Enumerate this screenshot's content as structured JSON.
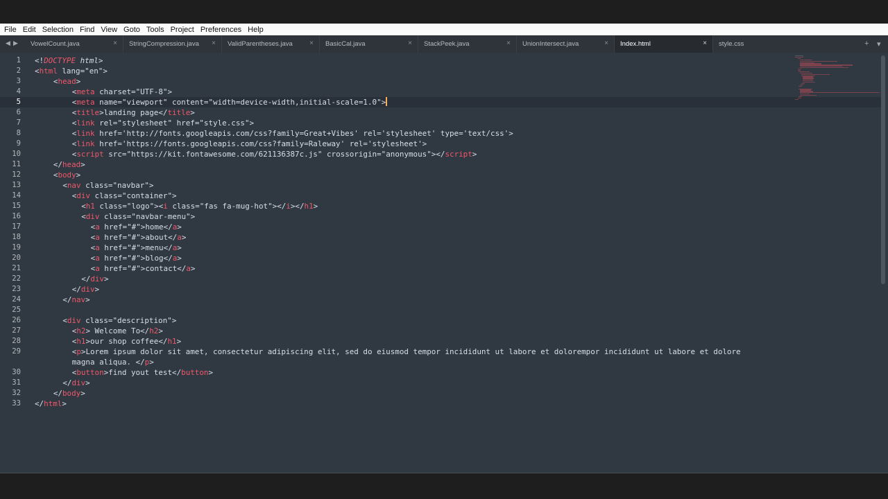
{
  "menu": [
    "File",
    "Edit",
    "Selection",
    "Find",
    "View",
    "Goto",
    "Tools",
    "Project",
    "Preferences",
    "Help"
  ],
  "tabs": [
    {
      "label": "VowelCount.java",
      "active": false
    },
    {
      "label": "StringCompression.java",
      "active": false
    },
    {
      "label": "ValidParentheses.java",
      "active": false
    },
    {
      "label": "BasicCal.java",
      "active": false
    },
    {
      "label": "StackPeek.java",
      "active": false
    },
    {
      "label": "UnionIntersect.java",
      "active": false
    },
    {
      "label": "Index.html",
      "active": true
    },
    {
      "label": "style.css",
      "active": false
    }
  ],
  "icons": {
    "nav_left": "◀",
    "nav_right": "▶",
    "close": "×",
    "new_tab": "+",
    "tab_list": "▾"
  },
  "colors": {
    "editor_bg": "#303841",
    "tag": "#f0586b",
    "text": "#d8dee9",
    "caret": "#f9ae58",
    "tab_bar": "#2f343a",
    "active_tab": "#272b30"
  },
  "editor": {
    "current_line": 5,
    "lines": [
      {
        "n": "1",
        "indent": 0,
        "tokens": [
          [
            "punc",
            "<!"
          ],
          [
            "doctype-kw",
            "DOCTYPE"
          ],
          [
            "punc",
            " "
          ],
          [
            "doctype",
            "html"
          ],
          [
            "punc",
            ">"
          ]
        ]
      },
      {
        "n": "2",
        "indent": 0,
        "tokens": [
          [
            "punc",
            "<"
          ],
          [
            "tag",
            "html"
          ],
          [
            "attr",
            " lang="
          ],
          [
            "str",
            "\"en\""
          ],
          [
            "punc",
            ">"
          ]
        ]
      },
      {
        "n": "3",
        "indent": 4,
        "tokens": [
          [
            "punc",
            "<"
          ],
          [
            "tag",
            "head"
          ],
          [
            "punc",
            ">"
          ]
        ]
      },
      {
        "n": "4",
        "indent": 8,
        "tokens": [
          [
            "punc",
            "<"
          ],
          [
            "tag",
            "meta"
          ],
          [
            "attr",
            " charset="
          ],
          [
            "str",
            "\"UTF-8\""
          ],
          [
            "punc",
            ">"
          ]
        ]
      },
      {
        "n": "5",
        "indent": 8,
        "tokens": [
          [
            "punc",
            "<"
          ],
          [
            "tag",
            "meta"
          ],
          [
            "attr",
            " name="
          ],
          [
            "str",
            "\"viewport\""
          ],
          [
            "attr",
            " content="
          ],
          [
            "str",
            "\"width=device-width,initial-scale=1.0\""
          ],
          [
            "punc",
            ">"
          ],
          [
            "caret",
            ""
          ]
        ]
      },
      {
        "n": "6",
        "indent": 8,
        "tokens": [
          [
            "punc",
            "<"
          ],
          [
            "tag",
            "title"
          ],
          [
            "punc",
            ">"
          ],
          [
            "text",
            "landing page"
          ],
          [
            "punc",
            "</"
          ],
          [
            "tag",
            "title"
          ],
          [
            "punc",
            ">"
          ]
        ]
      },
      {
        "n": "7",
        "indent": 8,
        "tokens": [
          [
            "punc",
            "<"
          ],
          [
            "tag",
            "link"
          ],
          [
            "attr",
            " rel="
          ],
          [
            "str",
            "\"stylesheet\""
          ],
          [
            "attr",
            " href="
          ],
          [
            "str",
            "\"style.css\""
          ],
          [
            "punc",
            ">"
          ]
        ]
      },
      {
        "n": "8",
        "indent": 8,
        "tokens": [
          [
            "punc",
            "<"
          ],
          [
            "tag",
            "link"
          ],
          [
            "attr",
            " href="
          ],
          [
            "str",
            "'http://fonts.googleapis.com/css?family=Great+Vibes'"
          ],
          [
            "attr",
            " rel="
          ],
          [
            "str",
            "'stylesheet'"
          ],
          [
            "attr",
            " type="
          ],
          [
            "str",
            "'text/css'"
          ],
          [
            "punc",
            ">"
          ]
        ]
      },
      {
        "n": "9",
        "indent": 8,
        "tokens": [
          [
            "punc",
            "<"
          ],
          [
            "tag",
            "link"
          ],
          [
            "attr",
            " href="
          ],
          [
            "str",
            "'https://fonts.googleapis.com/css?family=Raleway'"
          ],
          [
            "attr",
            " rel="
          ],
          [
            "str",
            "'stylesheet'"
          ],
          [
            "punc",
            ">"
          ]
        ]
      },
      {
        "n": "10",
        "indent": 8,
        "tokens": [
          [
            "punc",
            "<"
          ],
          [
            "tag",
            "script"
          ],
          [
            "attr",
            " src="
          ],
          [
            "str",
            "\"https://kit.fontawesome.com/621136387c.js\""
          ],
          [
            "attr",
            " crossorigin="
          ],
          [
            "str",
            "\"anonymous\""
          ],
          [
            "punc",
            "></"
          ],
          [
            "tag",
            "script"
          ],
          [
            "punc",
            ">"
          ]
        ]
      },
      {
        "n": "11",
        "indent": 4,
        "tokens": [
          [
            "punc",
            "</"
          ],
          [
            "tag",
            "head"
          ],
          [
            "punc",
            ">"
          ]
        ]
      },
      {
        "n": "12",
        "indent": 4,
        "tokens": [
          [
            "punc",
            "<"
          ],
          [
            "tag",
            "body"
          ],
          [
            "punc",
            ">"
          ]
        ]
      },
      {
        "n": "13",
        "indent": 6,
        "tokens": [
          [
            "punc",
            "<"
          ],
          [
            "tag",
            "nav"
          ],
          [
            "attr",
            " class="
          ],
          [
            "str",
            "\"navbar\""
          ],
          [
            "punc",
            ">"
          ]
        ]
      },
      {
        "n": "14",
        "indent": 8,
        "tokens": [
          [
            "punc",
            "<"
          ],
          [
            "tag",
            "div"
          ],
          [
            "attr",
            " class="
          ],
          [
            "str",
            "\"container\""
          ],
          [
            "punc",
            ">"
          ]
        ]
      },
      {
        "n": "15",
        "indent": 10,
        "tokens": [
          [
            "punc",
            "<"
          ],
          [
            "tag",
            "h1"
          ],
          [
            "attr",
            " class="
          ],
          [
            "str",
            "\"logo\""
          ],
          [
            "punc",
            ">"
          ],
          [
            "punc",
            "<"
          ],
          [
            "tag",
            "i"
          ],
          [
            "attr",
            " class="
          ],
          [
            "str",
            "\"fas fa-mug-hot\""
          ],
          [
            "punc",
            "></"
          ],
          [
            "tag",
            "i"
          ],
          [
            "punc",
            "></"
          ],
          [
            "tag",
            "h1"
          ],
          [
            "punc",
            ">"
          ]
        ]
      },
      {
        "n": "16",
        "indent": 10,
        "tokens": [
          [
            "punc",
            "<"
          ],
          [
            "tag",
            "div"
          ],
          [
            "attr",
            " class="
          ],
          [
            "str",
            "\"navbar-menu\""
          ],
          [
            "punc",
            ">"
          ]
        ]
      },
      {
        "n": "17",
        "indent": 12,
        "tokens": [
          [
            "punc",
            "<"
          ],
          [
            "tag",
            "a"
          ],
          [
            "attr",
            " href="
          ],
          [
            "str",
            "\"#\""
          ],
          [
            "punc",
            ">"
          ],
          [
            "text",
            "home"
          ],
          [
            "punc",
            "</"
          ],
          [
            "tag",
            "a"
          ],
          [
            "punc",
            ">"
          ]
        ]
      },
      {
        "n": "18",
        "indent": 12,
        "tokens": [
          [
            "punc",
            "<"
          ],
          [
            "tag",
            "a"
          ],
          [
            "attr",
            " href="
          ],
          [
            "str",
            "\"#\""
          ],
          [
            "punc",
            ">"
          ],
          [
            "text",
            "about"
          ],
          [
            "punc",
            "</"
          ],
          [
            "tag",
            "a"
          ],
          [
            "punc",
            ">"
          ]
        ]
      },
      {
        "n": "19",
        "indent": 12,
        "tokens": [
          [
            "punc",
            "<"
          ],
          [
            "tag",
            "a"
          ],
          [
            "attr",
            " href="
          ],
          [
            "str",
            "\"#\""
          ],
          [
            "punc",
            ">"
          ],
          [
            "text",
            "menu"
          ],
          [
            "punc",
            "</"
          ],
          [
            "tag",
            "a"
          ],
          [
            "punc",
            ">"
          ]
        ]
      },
      {
        "n": "20",
        "indent": 12,
        "tokens": [
          [
            "punc",
            "<"
          ],
          [
            "tag",
            "a"
          ],
          [
            "attr",
            " href="
          ],
          [
            "str",
            "\"#\""
          ],
          [
            "punc",
            ">"
          ],
          [
            "text",
            "blog"
          ],
          [
            "punc",
            "</"
          ],
          [
            "tag",
            "a"
          ],
          [
            "punc",
            ">"
          ]
        ]
      },
      {
        "n": "21",
        "indent": 12,
        "tokens": [
          [
            "punc",
            "<"
          ],
          [
            "tag",
            "a"
          ],
          [
            "attr",
            " href="
          ],
          [
            "str",
            "\"#\""
          ],
          [
            "punc",
            ">"
          ],
          [
            "text",
            "contact"
          ],
          [
            "punc",
            "</"
          ],
          [
            "tag",
            "a"
          ],
          [
            "punc",
            ">"
          ]
        ]
      },
      {
        "n": "22",
        "indent": 10,
        "tokens": [
          [
            "punc",
            "</"
          ],
          [
            "tag",
            "div"
          ],
          [
            "punc",
            ">"
          ]
        ]
      },
      {
        "n": "23",
        "indent": 8,
        "tokens": [
          [
            "punc",
            "</"
          ],
          [
            "tag",
            "div"
          ],
          [
            "punc",
            ">"
          ]
        ]
      },
      {
        "n": "24",
        "indent": 6,
        "tokens": [
          [
            "punc",
            "</"
          ],
          [
            "tag",
            "nav"
          ],
          [
            "punc",
            ">"
          ]
        ]
      },
      {
        "n": "25",
        "indent": 0,
        "tokens": []
      },
      {
        "n": "26",
        "indent": 6,
        "tokens": [
          [
            "punc",
            "<"
          ],
          [
            "tag",
            "div"
          ],
          [
            "attr",
            " class="
          ],
          [
            "str",
            "\"description\""
          ],
          [
            "punc",
            ">"
          ]
        ]
      },
      {
        "n": "27",
        "indent": 8,
        "tokens": [
          [
            "punc",
            "<"
          ],
          [
            "tag",
            "h2"
          ],
          [
            "punc",
            ">"
          ],
          [
            "text",
            " Welcome To"
          ],
          [
            "punc",
            "</"
          ],
          [
            "tag",
            "h2"
          ],
          [
            "punc",
            ">"
          ]
        ]
      },
      {
        "n": "28",
        "indent": 8,
        "tokens": [
          [
            "punc",
            "<"
          ],
          [
            "tag",
            "h1"
          ],
          [
            "punc",
            ">"
          ],
          [
            "text",
            "our shop coffee"
          ],
          [
            "punc",
            "</"
          ],
          [
            "tag",
            "h1"
          ],
          [
            "punc",
            ">"
          ]
        ]
      },
      {
        "n": "29",
        "indent": 8,
        "tokens": [
          [
            "punc",
            "<"
          ],
          [
            "tag",
            "p"
          ],
          [
            "punc",
            ">"
          ],
          [
            "text",
            "Lorem ipsum dolor sit amet, consectetur adipiscing elit, sed do eiusmod tempor incididunt ut labore et dolorempor incididunt ut labore et dolore"
          ]
        ]
      },
      {
        "n": "",
        "indent": 8,
        "tokens": [
          [
            "text",
            "magna aliqua. "
          ],
          [
            "punc",
            "</"
          ],
          [
            "tag",
            "p"
          ],
          [
            "punc",
            ">"
          ]
        ]
      },
      {
        "n": "30",
        "indent": 8,
        "tokens": [
          [
            "punc",
            "<"
          ],
          [
            "tag",
            "button"
          ],
          [
            "punc",
            ">"
          ],
          [
            "text",
            "find yout test"
          ],
          [
            "punc",
            "</"
          ],
          [
            "tag",
            "button"
          ],
          [
            "punc",
            ">"
          ]
        ]
      },
      {
        "n": "31",
        "indent": 6,
        "tokens": [
          [
            "punc",
            "</"
          ],
          [
            "tag",
            "div"
          ],
          [
            "punc",
            ">"
          ]
        ]
      },
      {
        "n": "32",
        "indent": 4,
        "tokens": [
          [
            "punc",
            "</"
          ],
          [
            "tag",
            "body"
          ],
          [
            "punc",
            ">"
          ]
        ]
      },
      {
        "n": "33",
        "indent": 0,
        "tokens": [
          [
            "punc",
            "</"
          ],
          [
            "tag",
            "html"
          ],
          [
            "punc",
            ">"
          ]
        ]
      }
    ]
  }
}
